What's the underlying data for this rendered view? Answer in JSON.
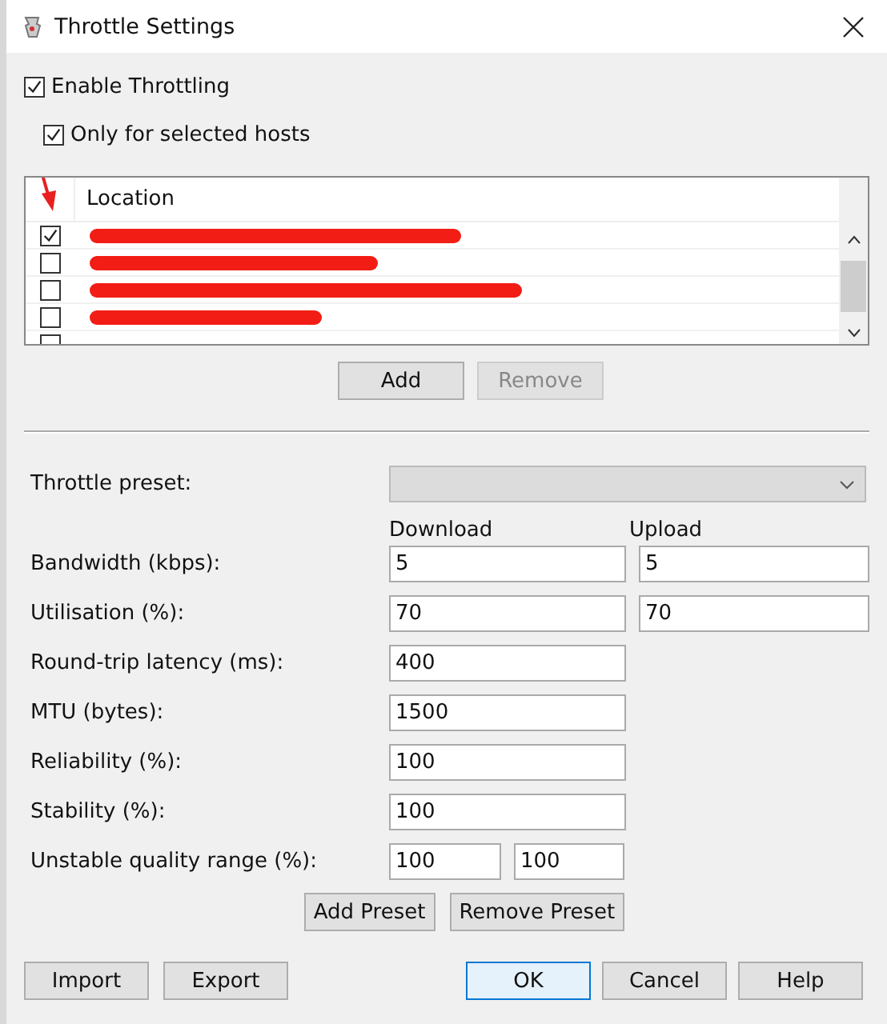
{
  "window": {
    "title": "Throttle Settings"
  },
  "enable_throttling": {
    "label": "Enable Throttling",
    "checked": true
  },
  "only_selected_hosts": {
    "label": "Only for selected hosts",
    "checked": true
  },
  "hosts": {
    "column": "Location",
    "rows": [
      {
        "checked": true,
        "redacted": true
      },
      {
        "checked": false,
        "redacted": true
      },
      {
        "checked": false,
        "redacted": true
      },
      {
        "checked": false,
        "redacted": true
      },
      {
        "redacted": false
      }
    ]
  },
  "host_buttons": [
    {
      "label": "Add",
      "disabled": false
    },
    {
      "label": "Remove",
      "disabled": true
    }
  ],
  "preset": {
    "label": "Throttle preset:",
    "disabled": true
  },
  "columns": [
    "Download",
    "Upload"
  ],
  "fields": [
    {
      "kind": "pair",
      "label": "Bandwidth (kbps):",
      "values": [
        "5",
        "5"
      ]
    },
    {
      "kind": "pair",
      "label": "Utilisation (%):",
      "values": [
        "70",
        "70"
      ]
    },
    {
      "kind": "single",
      "label": "Round-trip latency (ms):",
      "values": [
        "400"
      ]
    },
    {
      "kind": "single",
      "label": "MTU (bytes):",
      "values": [
        "1500"
      ]
    },
    {
      "kind": "single",
      "label": "Reliability (%):",
      "values": [
        "100"
      ]
    },
    {
      "kind": "single",
      "label": "Stability (%):",
      "values": [
        "100"
      ]
    },
    {
      "kind": "range",
      "label": "Unstable quality range (%):",
      "values": [
        "100",
        "100"
      ]
    }
  ],
  "preset_buttons": [
    {
      "label": "Add Preset",
      "default": false
    },
    {
      "label": "Remove Preset",
      "default": false
    }
  ],
  "footer_left": [
    {
      "label": "Import",
      "default": false
    },
    {
      "label": "Export",
      "default": false
    }
  ],
  "footer_right": [
    {
      "label": "OK",
      "default": true
    },
    {
      "label": "Cancel",
      "default": false
    },
    {
      "label": "Help",
      "default": false
    }
  ]
}
